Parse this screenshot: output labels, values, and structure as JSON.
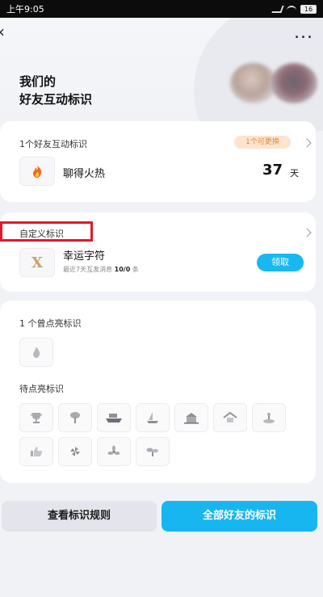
{
  "status_bar": {
    "time": "上午9:05",
    "battery": "16"
  },
  "header": {
    "title_line1": "我们的",
    "title_line2": "好友互动标识",
    "more_glyph": "..."
  },
  "friend_card": {
    "label": "1个好友互动标识",
    "replace_pill": "1个可更换",
    "badge_name": "聊得火热",
    "days_value": "37",
    "days_unit": "天"
  },
  "custom_card": {
    "label": "自定义标识",
    "badge_name": "幸运字符",
    "sub_prefix": "最近7天互发消息",
    "sub_value": "10/0",
    "sub_suffix": "条",
    "claim_label": "领取",
    "badge_letter": "X"
  },
  "badges_card": {
    "lit_label": "1 个曾点亮标识",
    "pending_label": "待点亮标识"
  },
  "bottom": {
    "rules_label": "查看标识规则",
    "all_label": "全部好友的标识"
  },
  "colors": {
    "accent": "#17b6f1",
    "highlight": "#e5182b",
    "pill_bg": "#fde4cf",
    "pill_text": "#e08a3c"
  }
}
